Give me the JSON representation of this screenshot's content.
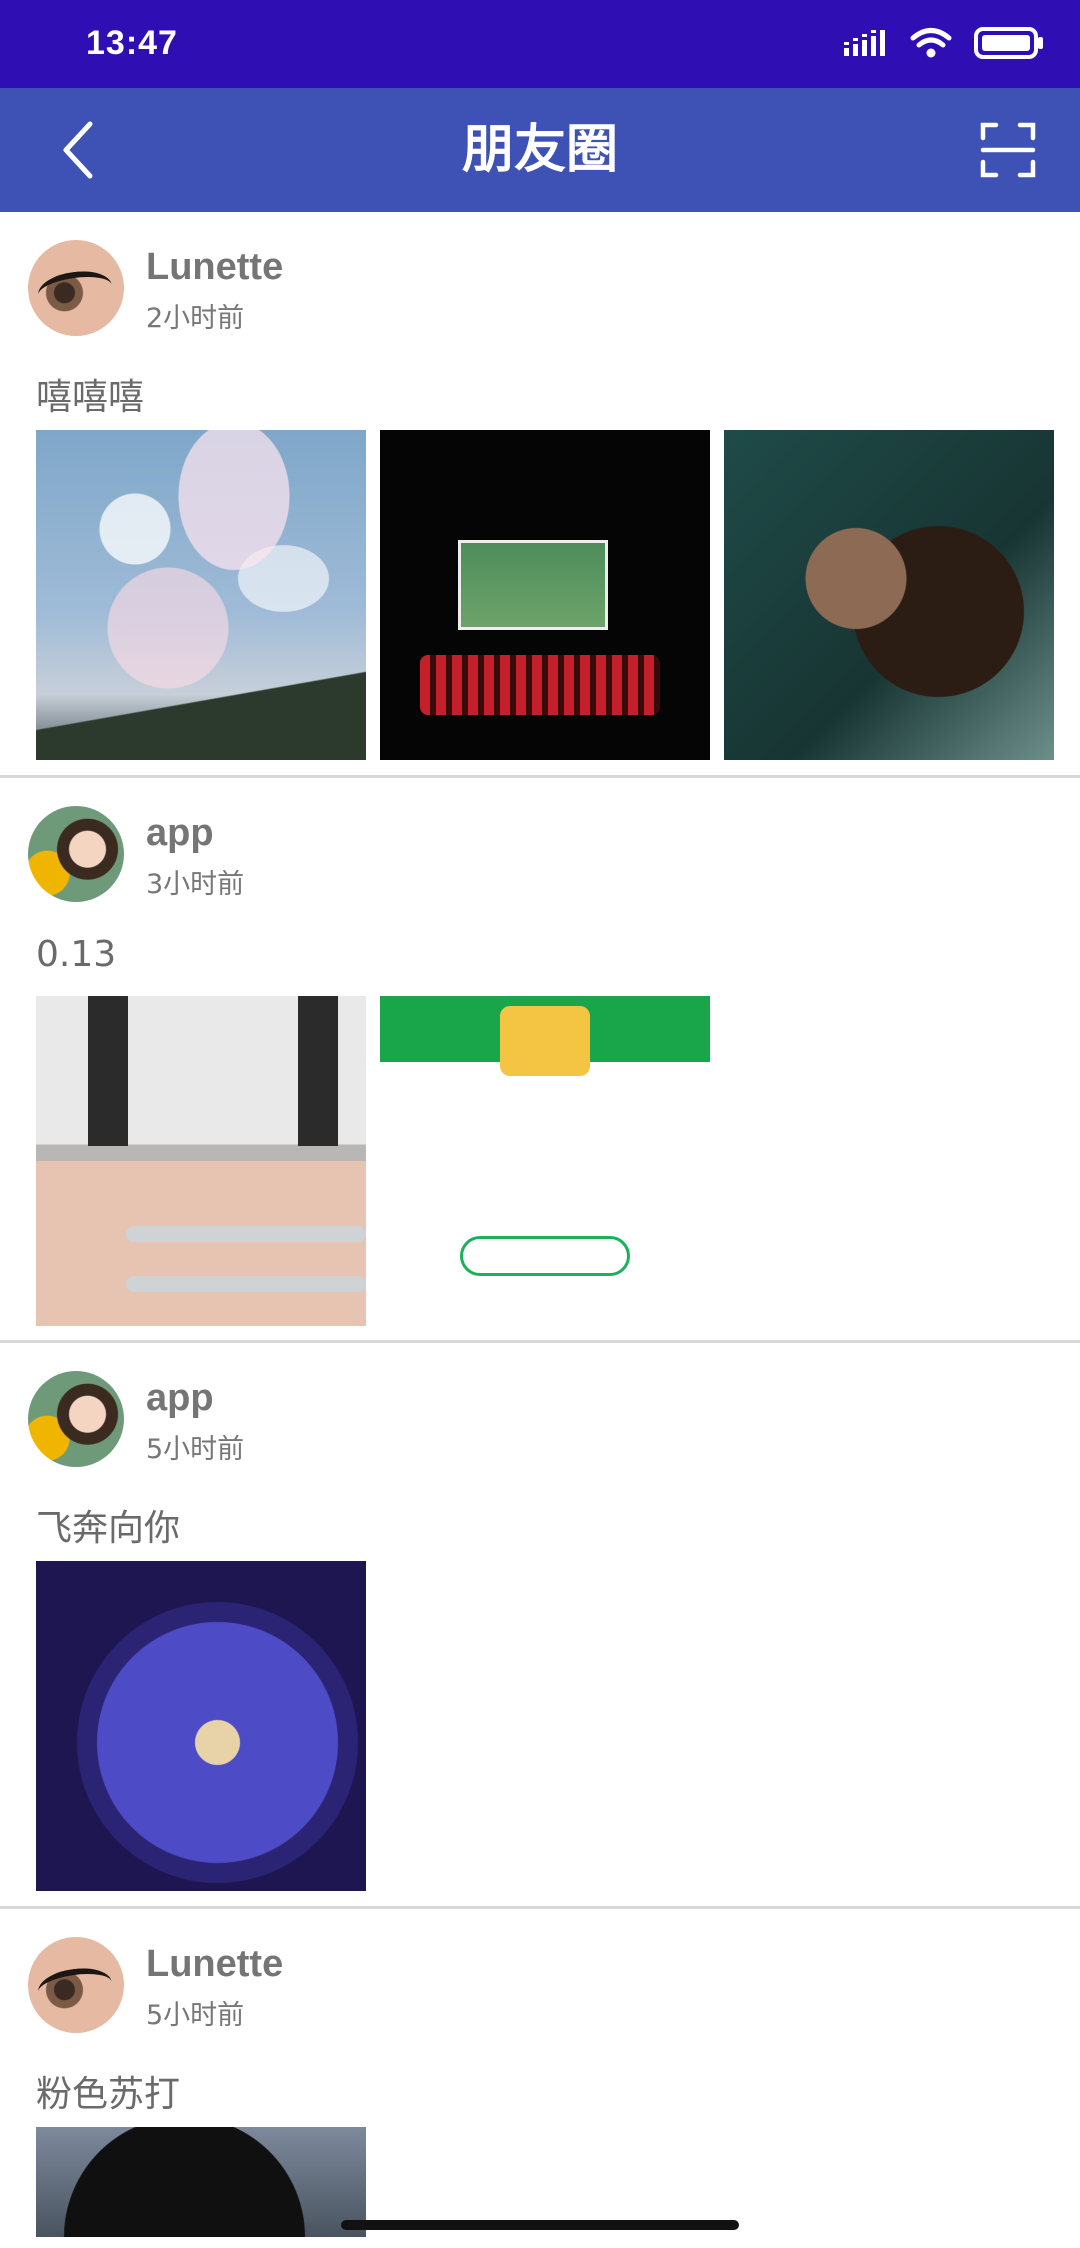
{
  "status_bar": {
    "time": "13:47"
  },
  "header": {
    "title": "朋友圈"
  },
  "posts": [
    {
      "user": "Lunette",
      "time": "2小时前",
      "text": "嘻嘻嘻",
      "photos": [
        "sky-photo",
        "phone-screen-photo",
        "hug-photo"
      ]
    },
    {
      "user": "app",
      "time": "3小时前",
      "text": "0.13",
      "photos": [
        "building-wall-photo",
        "tree-certificate-photo"
      ]
    },
    {
      "user": "app",
      "time": "5小时前",
      "text": "飞奔向你",
      "photos": [
        "illustration-photo"
      ]
    },
    {
      "user": "Lunette",
      "time": "5小时前",
      "text": "粉色苏打",
      "photos": [
        "vinyl-record-photo"
      ]
    }
  ],
  "colors": {
    "status_bar": "#2f0fb3",
    "app_bar": "#3e51b5",
    "divider": "#d8d8d8"
  }
}
